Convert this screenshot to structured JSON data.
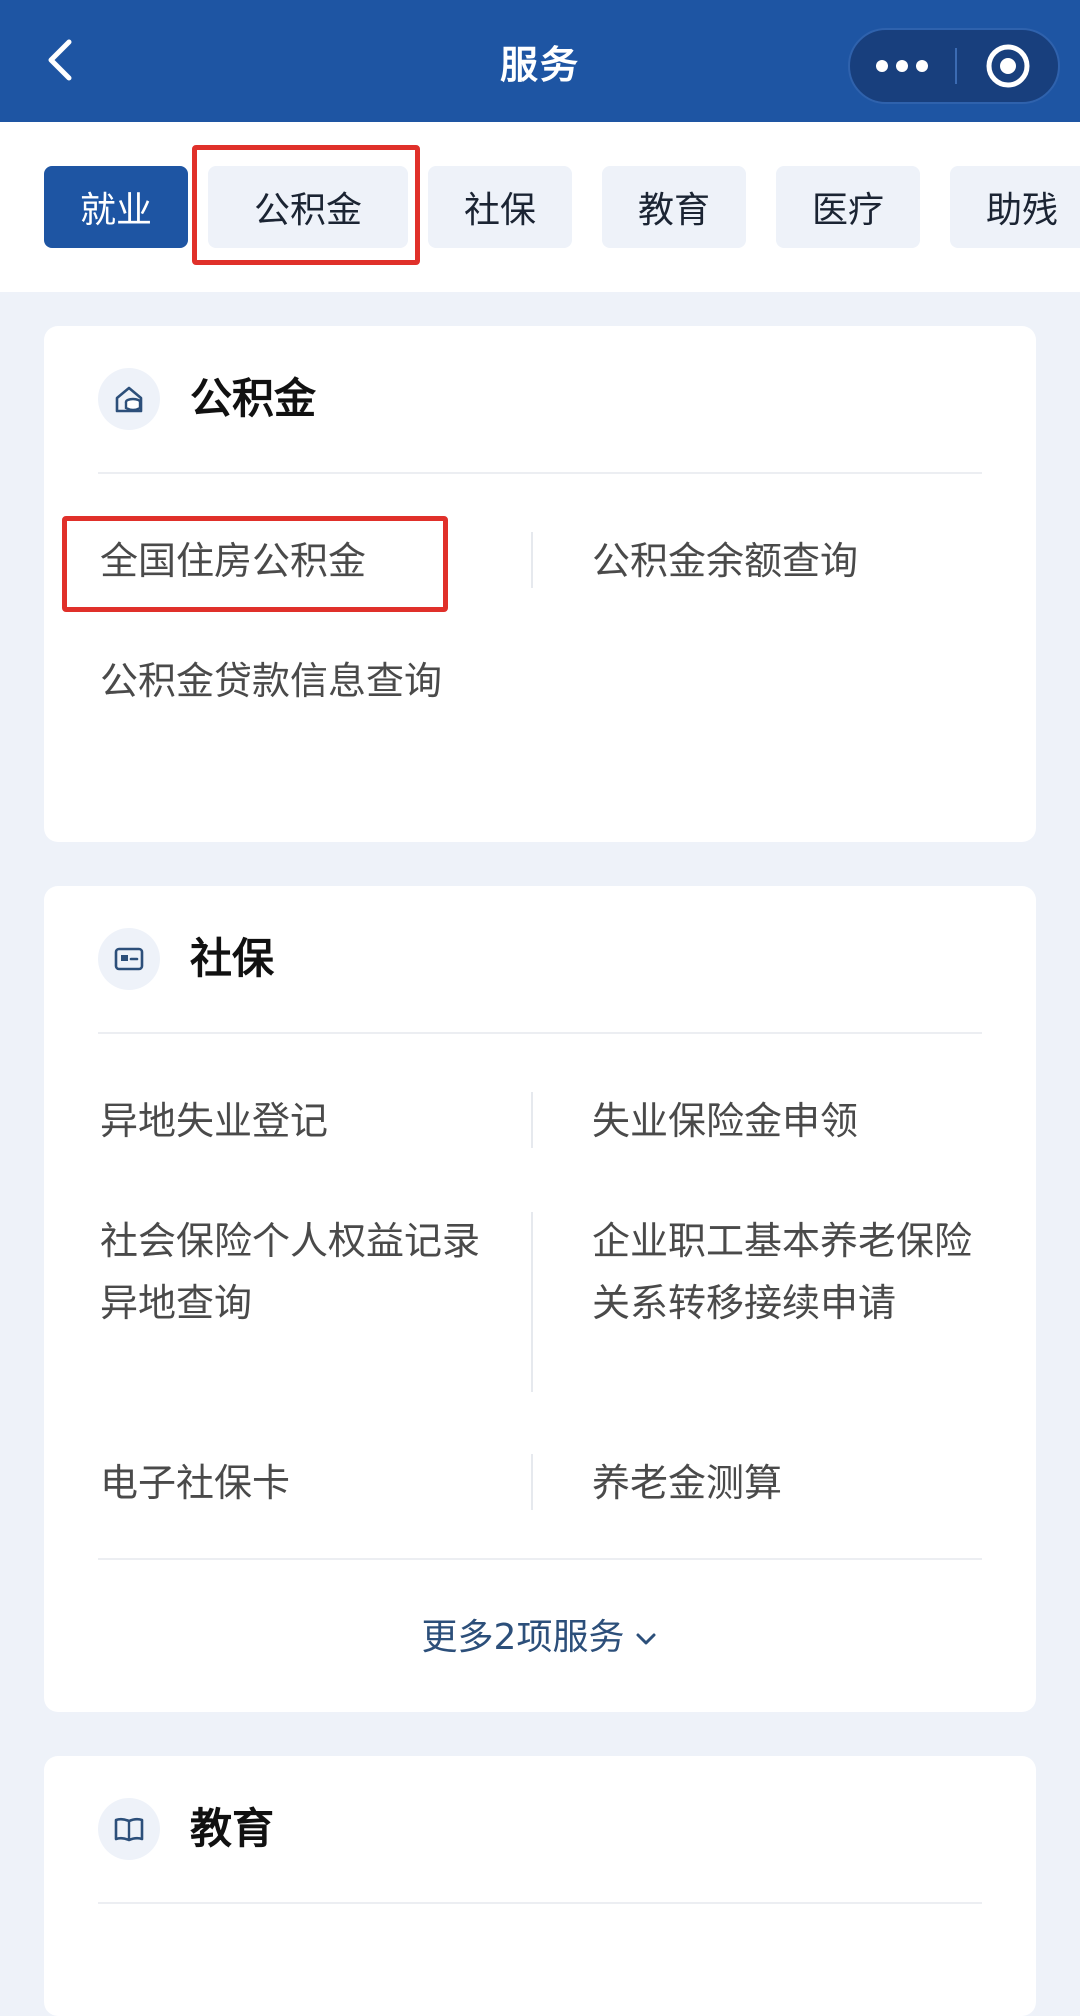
{
  "header": {
    "title": "服务",
    "icons": {
      "back": "back-arrow-icon",
      "more": "more-dots-icon",
      "close": "target-circle-icon"
    }
  },
  "tabs": [
    {
      "label": "就业",
      "active": true
    },
    {
      "label": "公积金",
      "active": false
    },
    {
      "label": "社保",
      "active": false
    },
    {
      "label": "教育",
      "active": false
    },
    {
      "label": "医疗",
      "active": false
    },
    {
      "label": "助残",
      "active": false
    }
  ],
  "sections": {
    "housing_fund": {
      "title": "公积金",
      "icon": "house-coin-icon",
      "items": [
        "全国住房公积金",
        "公积金余额查询",
        "公积金贷款信息查询"
      ]
    },
    "social_security": {
      "title": "社保",
      "icon": "id-card-icon",
      "items": [
        "异地失业登记",
        "失业保险金申领",
        "社会保险个人权益记录异地查询",
        "企业职工基本养老保险关系转移接续申请",
        "电子社保卡",
        "养老金测算"
      ],
      "more_label": "更多2项服务"
    },
    "education": {
      "title": "教育",
      "icon": "open-book-icon"
    }
  },
  "colors": {
    "header_blue": "#1e55a3",
    "highlight_red": "#e0302a",
    "background": "#eef2f9"
  }
}
